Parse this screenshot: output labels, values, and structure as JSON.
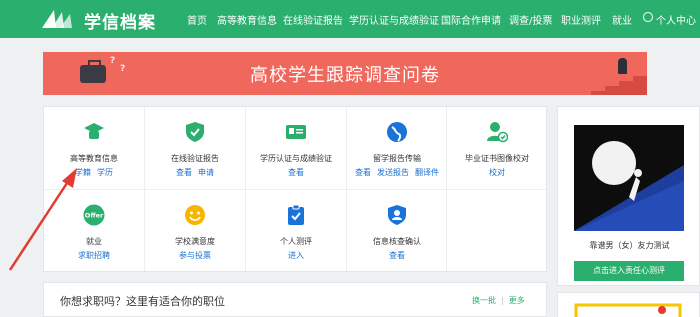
{
  "brand": {
    "name": "学信档案"
  },
  "nav": {
    "items": [
      "首页",
      "高等教育信息",
      "在线验证报告",
      "学历认证与成绩验证",
      "国际合作申请",
      "调查/投票",
      "职业测评",
      "就业"
    ],
    "user": "个人中心"
  },
  "banner": {
    "title": "高校学生跟踪调查问卷"
  },
  "services": [
    {
      "title": "高等教育信息",
      "links": [
        "学籍",
        "学历"
      ]
    },
    {
      "title": "在线验证报告",
      "links": [
        "查看",
        "申请"
      ]
    },
    {
      "title": "学历认证与成绩验证",
      "links": [
        "查看"
      ]
    },
    {
      "title": "留学报告传输",
      "links": [
        "查看",
        "发送报告",
        "翻译件"
      ]
    },
    {
      "title": "毕业证书图像校对",
      "links": [
        "校对"
      ]
    },
    {
      "title": "就业",
      "links": [
        "求职招聘"
      ]
    },
    {
      "title": "学校满意度",
      "links": [
        "参与投票"
      ]
    },
    {
      "title": "个人测评",
      "links": [
        "进入"
      ]
    },
    {
      "title": "信息核查确认",
      "links": [
        "查看"
      ]
    }
  ],
  "jobs": {
    "title": "你想求职吗？这里有适合你的职位",
    "change": "换一批",
    "more": "更多"
  },
  "side": {
    "caption": "靠谱男（女）友力测试",
    "button": "点击进入责任心测评"
  },
  "colors": {
    "brand_green": "#2baf6f",
    "banner_red": "#f0675c",
    "link_blue": "#1a6fd0",
    "arrow_red": "#e23b32"
  },
  "icons": [
    "grad-cap-icon",
    "shield-check-icon",
    "id-card-icon",
    "globe-icon",
    "user-check-icon",
    "offer-icon",
    "smiley-icon",
    "checklist-icon",
    "user-shield-icon"
  ]
}
